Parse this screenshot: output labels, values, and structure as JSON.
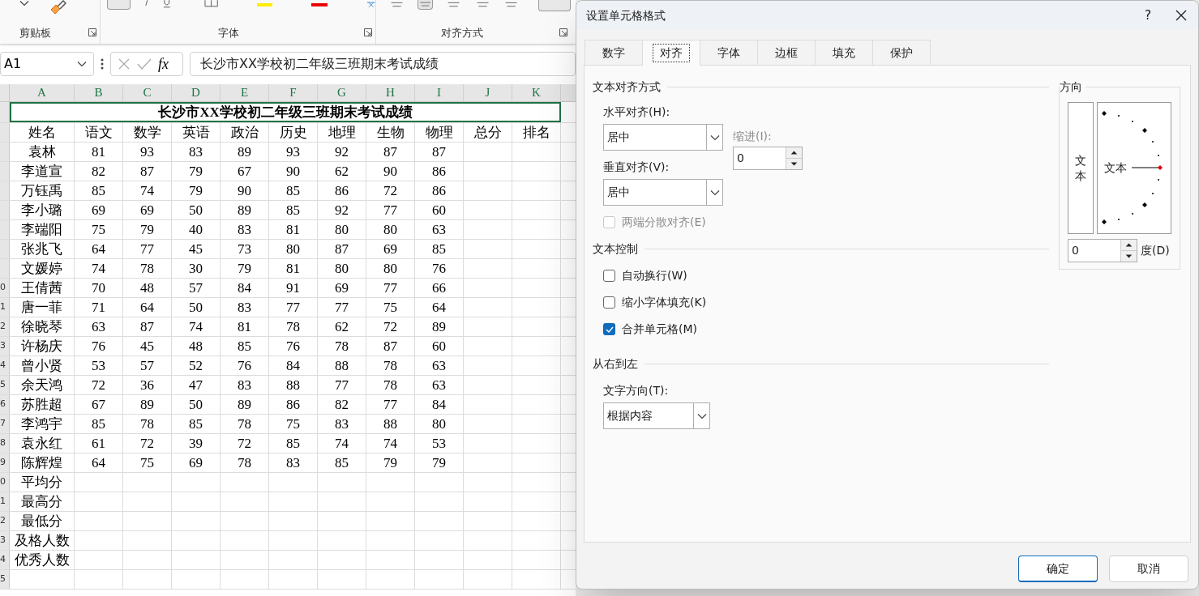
{
  "ribbon": {
    "groups": [
      {
        "label": "剪贴板"
      },
      {
        "label": "字体"
      },
      {
        "label": "对齐方式"
      }
    ]
  },
  "formula_bar": {
    "name_box": "A1",
    "function_label": "fx",
    "value": "长沙市XX学校初二年级三班期末考试成绩"
  },
  "sheet": {
    "columns": [
      "A",
      "B",
      "C",
      "D",
      "E",
      "F",
      "G",
      "H",
      "I",
      "J",
      "K"
    ],
    "title": {
      "text": "长沙市XX学校初二年级三班期末考试成绩",
      "selected": true
    },
    "rows": [
      {
        "cells": [
          "姓名",
          "语文",
          "数学",
          "英语",
          "政治",
          "历史",
          "地理",
          "生物",
          "物理",
          "总分",
          "排名"
        ]
      },
      {
        "cells": [
          "袁林",
          "81",
          "93",
          "83",
          "89",
          "93",
          "92",
          "87",
          "87"
        ]
      },
      {
        "cells": [
          "李道宣",
          "82",
          "87",
          "79",
          "67",
          "90",
          "62",
          "90",
          "86"
        ]
      },
      {
        "cells": [
          "万钰禹",
          "85",
          "74",
          "79",
          "90",
          "85",
          "86",
          "72",
          "86"
        ]
      },
      {
        "cells": [
          "李小璐",
          "69",
          "69",
          "50",
          "89",
          "85",
          "92",
          "77",
          "60"
        ]
      },
      {
        "cells": [
          "李端阳",
          "75",
          "79",
          "40",
          "83",
          "81",
          "80",
          "80",
          "63"
        ]
      },
      {
        "cells": [
          "张兆飞",
          "64",
          "77",
          "45",
          "73",
          "80",
          "87",
          "69",
          "85"
        ]
      },
      {
        "cells": [
          "文媛婷",
          "74",
          "78",
          "30",
          "79",
          "81",
          "80",
          "80",
          "76"
        ]
      },
      {
        "number": "0",
        "cells": [
          "王倩茜",
          "70",
          "48",
          "57",
          "84",
          "91",
          "69",
          "77",
          "66"
        ]
      },
      {
        "number": "1",
        "cells": [
          "唐一菲",
          "71",
          "64",
          "50",
          "83",
          "77",
          "77",
          "75",
          "64"
        ]
      },
      {
        "number": "2",
        "cells": [
          "徐晓琴",
          "63",
          "87",
          "74",
          "81",
          "78",
          "62",
          "72",
          "89"
        ]
      },
      {
        "number": "3",
        "cells": [
          "许杨庆",
          "76",
          "45",
          "48",
          "85",
          "76",
          "78",
          "87",
          "60"
        ]
      },
      {
        "number": "4",
        "cells": [
          "曾小贤",
          "53",
          "57",
          "52",
          "76",
          "84",
          "88",
          "78",
          "63"
        ]
      },
      {
        "number": "5",
        "cells": [
          "余天鸿",
          "72",
          "36",
          "47",
          "83",
          "88",
          "77",
          "78",
          "63"
        ]
      },
      {
        "number": "6",
        "cells": [
          "苏胜超",
          "67",
          "89",
          "50",
          "89",
          "86",
          "82",
          "77",
          "84"
        ]
      },
      {
        "number": "7",
        "cells": [
          "李鸿宇",
          "85",
          "78",
          "85",
          "78",
          "75",
          "83",
          "88",
          "80"
        ]
      },
      {
        "number": "8",
        "cells": [
          "袁永红",
          "61",
          "72",
          "39",
          "72",
          "85",
          "74",
          "74",
          "53"
        ]
      },
      {
        "number": "9",
        "cells": [
          "陈辉煌",
          "64",
          "75",
          "69",
          "78",
          "83",
          "85",
          "79",
          "79"
        ]
      },
      {
        "number": "0",
        "cells": [
          "平均分"
        ]
      },
      {
        "number": "1",
        "cells": [
          "最高分"
        ]
      },
      {
        "number": "2",
        "cells": [
          "最低分"
        ]
      },
      {
        "number": "3",
        "cells": [
          "及格人数"
        ]
      },
      {
        "number": "4",
        "cells": [
          "优秀人数"
        ]
      },
      {
        "number": "5",
        "cells": []
      }
    ]
  },
  "dialog": {
    "title": "设置单元格格式",
    "help": "?",
    "tabs": [
      {
        "label": "数字",
        "selected": false
      },
      {
        "label": "对齐",
        "selected": true
      },
      {
        "label": "字体",
        "selected": false
      },
      {
        "label": "边框",
        "selected": false
      },
      {
        "label": "填充",
        "selected": false
      },
      {
        "label": "保护",
        "selected": false
      }
    ],
    "text_alignment": {
      "legend": "文本对齐方式",
      "horizontal": {
        "label": "水平对齐(H):",
        "value": "居中"
      },
      "vertical": {
        "label": "垂直对齐(V):",
        "value": "居中"
      },
      "indent": {
        "label": "缩进(I):",
        "value": "0",
        "disabled": true
      },
      "distributed": {
        "label": "两端分散对齐(E)",
        "checked": false,
        "disabled": true
      }
    },
    "text_control": {
      "legend": "文本控制",
      "options": [
        {
          "label": "自动换行(W)",
          "checked": false
        },
        {
          "label": "缩小字体填充(K)",
          "checked": false
        },
        {
          "label": "合并单元格(M)",
          "checked": true
        }
      ]
    },
    "right_to_left": {
      "legend": "从右到左",
      "direction": {
        "label": "文字方向(T):",
        "value": "根据内容"
      }
    },
    "orientation": {
      "legend": "方向",
      "vertical_text": "文本",
      "dial_text": "文本",
      "degrees": {
        "value": "0",
        "label": "度(D)"
      }
    },
    "buttons": [
      {
        "label": "确定",
        "primary": true
      },
      {
        "label": "取消",
        "primary": false
      }
    ]
  }
}
